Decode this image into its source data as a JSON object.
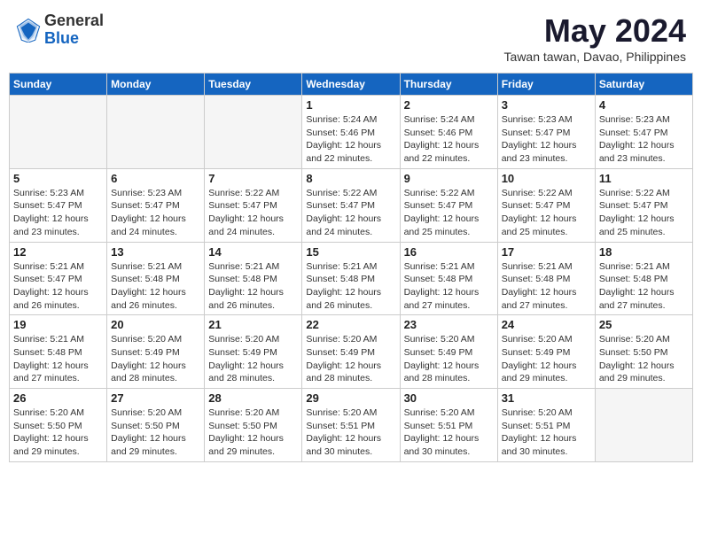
{
  "header": {
    "logo_general": "General",
    "logo_blue": "Blue",
    "month": "May 2024",
    "location": "Tawan tawan, Davao, Philippines"
  },
  "days_of_week": [
    "Sunday",
    "Monday",
    "Tuesday",
    "Wednesday",
    "Thursday",
    "Friday",
    "Saturday"
  ],
  "weeks": [
    [
      {
        "day": "",
        "empty": true
      },
      {
        "day": "",
        "empty": true
      },
      {
        "day": "",
        "empty": true
      },
      {
        "day": "1",
        "sunrise": "5:24 AM",
        "sunset": "5:46 PM",
        "daylight": "12 hours and 22 minutes."
      },
      {
        "day": "2",
        "sunrise": "5:24 AM",
        "sunset": "5:46 PM",
        "daylight": "12 hours and 22 minutes."
      },
      {
        "day": "3",
        "sunrise": "5:23 AM",
        "sunset": "5:47 PM",
        "daylight": "12 hours and 23 minutes."
      },
      {
        "day": "4",
        "sunrise": "5:23 AM",
        "sunset": "5:47 PM",
        "daylight": "12 hours and 23 minutes."
      }
    ],
    [
      {
        "day": "5",
        "sunrise": "5:23 AM",
        "sunset": "5:47 PM",
        "daylight": "12 hours and 23 minutes."
      },
      {
        "day": "6",
        "sunrise": "5:23 AM",
        "sunset": "5:47 PM",
        "daylight": "12 hours and 24 minutes."
      },
      {
        "day": "7",
        "sunrise": "5:22 AM",
        "sunset": "5:47 PM",
        "daylight": "12 hours and 24 minutes."
      },
      {
        "day": "8",
        "sunrise": "5:22 AM",
        "sunset": "5:47 PM",
        "daylight": "12 hours and 24 minutes."
      },
      {
        "day": "9",
        "sunrise": "5:22 AM",
        "sunset": "5:47 PM",
        "daylight": "12 hours and 25 minutes."
      },
      {
        "day": "10",
        "sunrise": "5:22 AM",
        "sunset": "5:47 PM",
        "daylight": "12 hours and 25 minutes."
      },
      {
        "day": "11",
        "sunrise": "5:22 AM",
        "sunset": "5:47 PM",
        "daylight": "12 hours and 25 minutes."
      }
    ],
    [
      {
        "day": "12",
        "sunrise": "5:21 AM",
        "sunset": "5:47 PM",
        "daylight": "12 hours and 26 minutes."
      },
      {
        "day": "13",
        "sunrise": "5:21 AM",
        "sunset": "5:48 PM",
        "daylight": "12 hours and 26 minutes."
      },
      {
        "day": "14",
        "sunrise": "5:21 AM",
        "sunset": "5:48 PM",
        "daylight": "12 hours and 26 minutes."
      },
      {
        "day": "15",
        "sunrise": "5:21 AM",
        "sunset": "5:48 PM",
        "daylight": "12 hours and 26 minutes."
      },
      {
        "day": "16",
        "sunrise": "5:21 AM",
        "sunset": "5:48 PM",
        "daylight": "12 hours and 27 minutes."
      },
      {
        "day": "17",
        "sunrise": "5:21 AM",
        "sunset": "5:48 PM",
        "daylight": "12 hours and 27 minutes."
      },
      {
        "day": "18",
        "sunrise": "5:21 AM",
        "sunset": "5:48 PM",
        "daylight": "12 hours and 27 minutes."
      }
    ],
    [
      {
        "day": "19",
        "sunrise": "5:21 AM",
        "sunset": "5:48 PM",
        "daylight": "12 hours and 27 minutes."
      },
      {
        "day": "20",
        "sunrise": "5:20 AM",
        "sunset": "5:49 PM",
        "daylight": "12 hours and 28 minutes."
      },
      {
        "day": "21",
        "sunrise": "5:20 AM",
        "sunset": "5:49 PM",
        "daylight": "12 hours and 28 minutes."
      },
      {
        "day": "22",
        "sunrise": "5:20 AM",
        "sunset": "5:49 PM",
        "daylight": "12 hours and 28 minutes."
      },
      {
        "day": "23",
        "sunrise": "5:20 AM",
        "sunset": "5:49 PM",
        "daylight": "12 hours and 28 minutes."
      },
      {
        "day": "24",
        "sunrise": "5:20 AM",
        "sunset": "5:49 PM",
        "daylight": "12 hours and 29 minutes."
      },
      {
        "day": "25",
        "sunrise": "5:20 AM",
        "sunset": "5:50 PM",
        "daylight": "12 hours and 29 minutes."
      }
    ],
    [
      {
        "day": "26",
        "sunrise": "5:20 AM",
        "sunset": "5:50 PM",
        "daylight": "12 hours and 29 minutes."
      },
      {
        "day": "27",
        "sunrise": "5:20 AM",
        "sunset": "5:50 PM",
        "daylight": "12 hours and 29 minutes."
      },
      {
        "day": "28",
        "sunrise": "5:20 AM",
        "sunset": "5:50 PM",
        "daylight": "12 hours and 29 minutes."
      },
      {
        "day": "29",
        "sunrise": "5:20 AM",
        "sunset": "5:51 PM",
        "daylight": "12 hours and 30 minutes."
      },
      {
        "day": "30",
        "sunrise": "5:20 AM",
        "sunset": "5:51 PM",
        "daylight": "12 hours and 30 minutes."
      },
      {
        "day": "31",
        "sunrise": "5:20 AM",
        "sunset": "5:51 PM",
        "daylight": "12 hours and 30 minutes."
      },
      {
        "day": "",
        "empty": true
      }
    ]
  ],
  "labels": {
    "sunrise": "Sunrise:",
    "sunset": "Sunset:",
    "daylight": "Daylight:"
  }
}
